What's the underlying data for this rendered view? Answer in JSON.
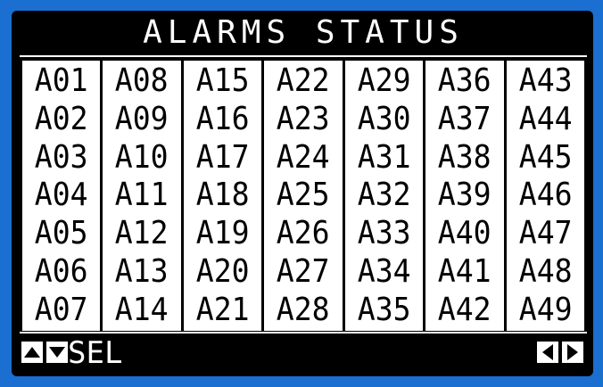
{
  "title": "ALARMS STATUS",
  "columns": [
    [
      "A01",
      "A02",
      "A03",
      "A04",
      "A05",
      "A06",
      "A07"
    ],
    [
      "A08",
      "A09",
      "A10",
      "A11",
      "A12",
      "A13",
      "A14"
    ],
    [
      "A15",
      "A16",
      "A17",
      "A18",
      "A19",
      "A20",
      "A21"
    ],
    [
      "A22",
      "A23",
      "A24",
      "A25",
      "A26",
      "A27",
      "A28"
    ],
    [
      "A29",
      "A30",
      "A31",
      "A32",
      "A33",
      "A34",
      "A35"
    ],
    [
      "A36",
      "A37",
      "A38",
      "A39",
      "A40",
      "A41",
      "A42"
    ],
    [
      "A43",
      "A44",
      "A45",
      "A46",
      "A47",
      "A48",
      "A49"
    ]
  ],
  "footer": {
    "sel_label": "SEL",
    "keys": [
      "up-arrow-icon",
      "down-arrow-icon",
      "left-arrow-icon",
      "right-arrow-icon"
    ]
  },
  "colors": {
    "bezel": "#1a6fd0",
    "screen": "#000000",
    "cell_background": "#ffffff",
    "text_dark": "#000000",
    "text_light": "#ffffff"
  }
}
